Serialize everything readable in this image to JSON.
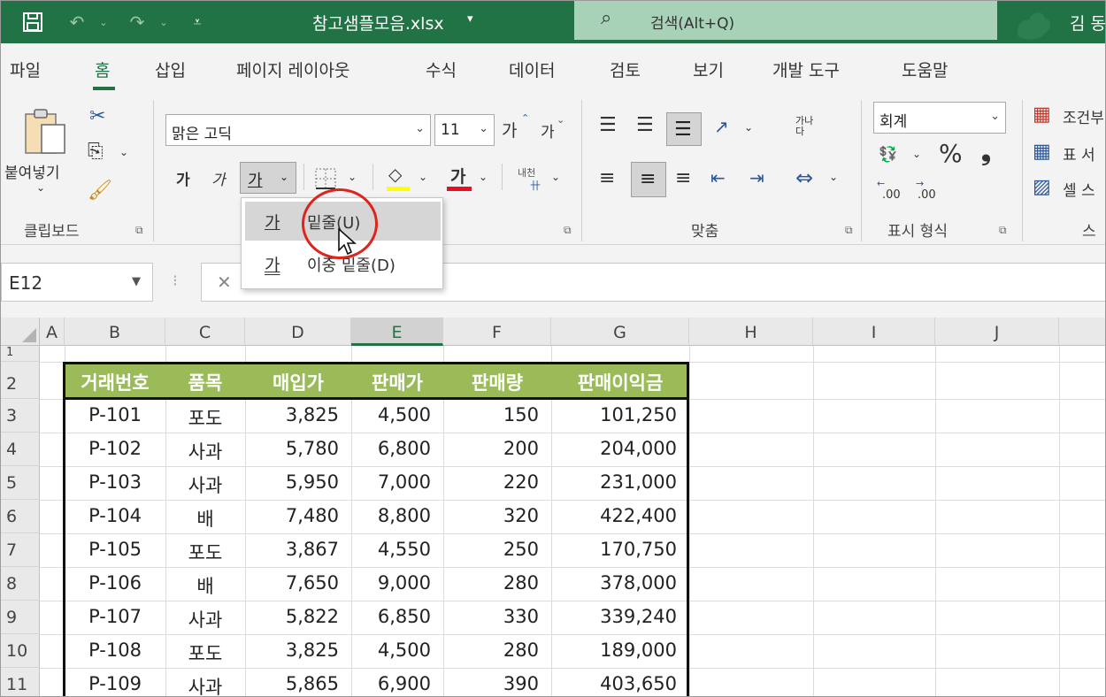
{
  "titlebar": {
    "doc_title": "참고샘플모음.xlsx",
    "doc_caret": "▾",
    "search_text": "검색(Alt+Q)",
    "user_name": "김 동",
    "icons": [
      "save-icon",
      "undo-icon",
      "redo-icon",
      "customize-qat-icon",
      "search-icon"
    ]
  },
  "tabs": [
    "파일",
    "홈",
    "삽입",
    "페이지 레이아웃",
    "수식",
    "데이터",
    "검토",
    "보기",
    "개발 도구",
    "도움말"
  ],
  "ribbon": {
    "clipboard": {
      "paste_label": "붙여넣기",
      "group_label": "클립보드"
    },
    "font": {
      "font_name": "맑은 고딕",
      "font_size": "11",
      "grow": "가",
      "shrink": "가",
      "bold": "가",
      "italic": "가",
      "underline": "가",
      "phonetic": "내천",
      "font_color_glyph": "가"
    },
    "alignment": {
      "group_label": "맞춤",
      "wrap": "가나다"
    },
    "number": {
      "format": "회계",
      "percent": "%",
      "comma": "❟",
      "dec_inc": ".00",
      "dec_dec": ".00",
      "group_label": "표시 형식"
    },
    "styles": {
      "cond_format": "조건부",
      "table_format": "표 서",
      "cell_styles": "셀 스",
      "group_label": "스"
    }
  },
  "underline_menu": {
    "items": [
      {
        "icon": "가",
        "label": "밑줄(U)"
      },
      {
        "icon": "가",
        "label": "이중 밑줄(D)"
      }
    ]
  },
  "formula_bar": {
    "name_box": "E12",
    "separator": "⁝",
    "cancel": "✕"
  },
  "sheet": {
    "columns": [
      "A",
      "B",
      "C",
      "D",
      "E",
      "F",
      "G",
      "H",
      "I",
      "J"
    ],
    "selected_column": "E",
    "rows": [
      "1",
      "2",
      "3",
      "4",
      "5",
      "6",
      "7",
      "8",
      "9",
      "10",
      "11"
    ],
    "header_fill": "#9bbb59",
    "table": {
      "headers": [
        "거래번호",
        "품목",
        "매입가",
        "판매가",
        "판매량",
        "판매이익금"
      ],
      "records": [
        [
          "P-101",
          "포도",
          "3,825",
          "4,500",
          "150",
          "101,250"
        ],
        [
          "P-102",
          "사과",
          "5,780",
          "6,800",
          "200",
          "204,000"
        ],
        [
          "P-103",
          "사과",
          "5,950",
          "7,000",
          "220",
          "231,000"
        ],
        [
          "P-104",
          "배",
          "7,480",
          "8,800",
          "320",
          "422,400"
        ],
        [
          "P-105",
          "포도",
          "3,867",
          "4,550",
          "250",
          "170,750"
        ],
        [
          "P-106",
          "배",
          "7,650",
          "9,000",
          "280",
          "378,000"
        ],
        [
          "P-107",
          "사과",
          "5,822",
          "6,850",
          "330",
          "339,240"
        ],
        [
          "P-108",
          "포도",
          "3,825",
          "4,500",
          "280",
          "189,000"
        ],
        [
          "P-109",
          "사과",
          "5,865",
          "6,900",
          "390",
          "403,650"
        ]
      ]
    }
  }
}
